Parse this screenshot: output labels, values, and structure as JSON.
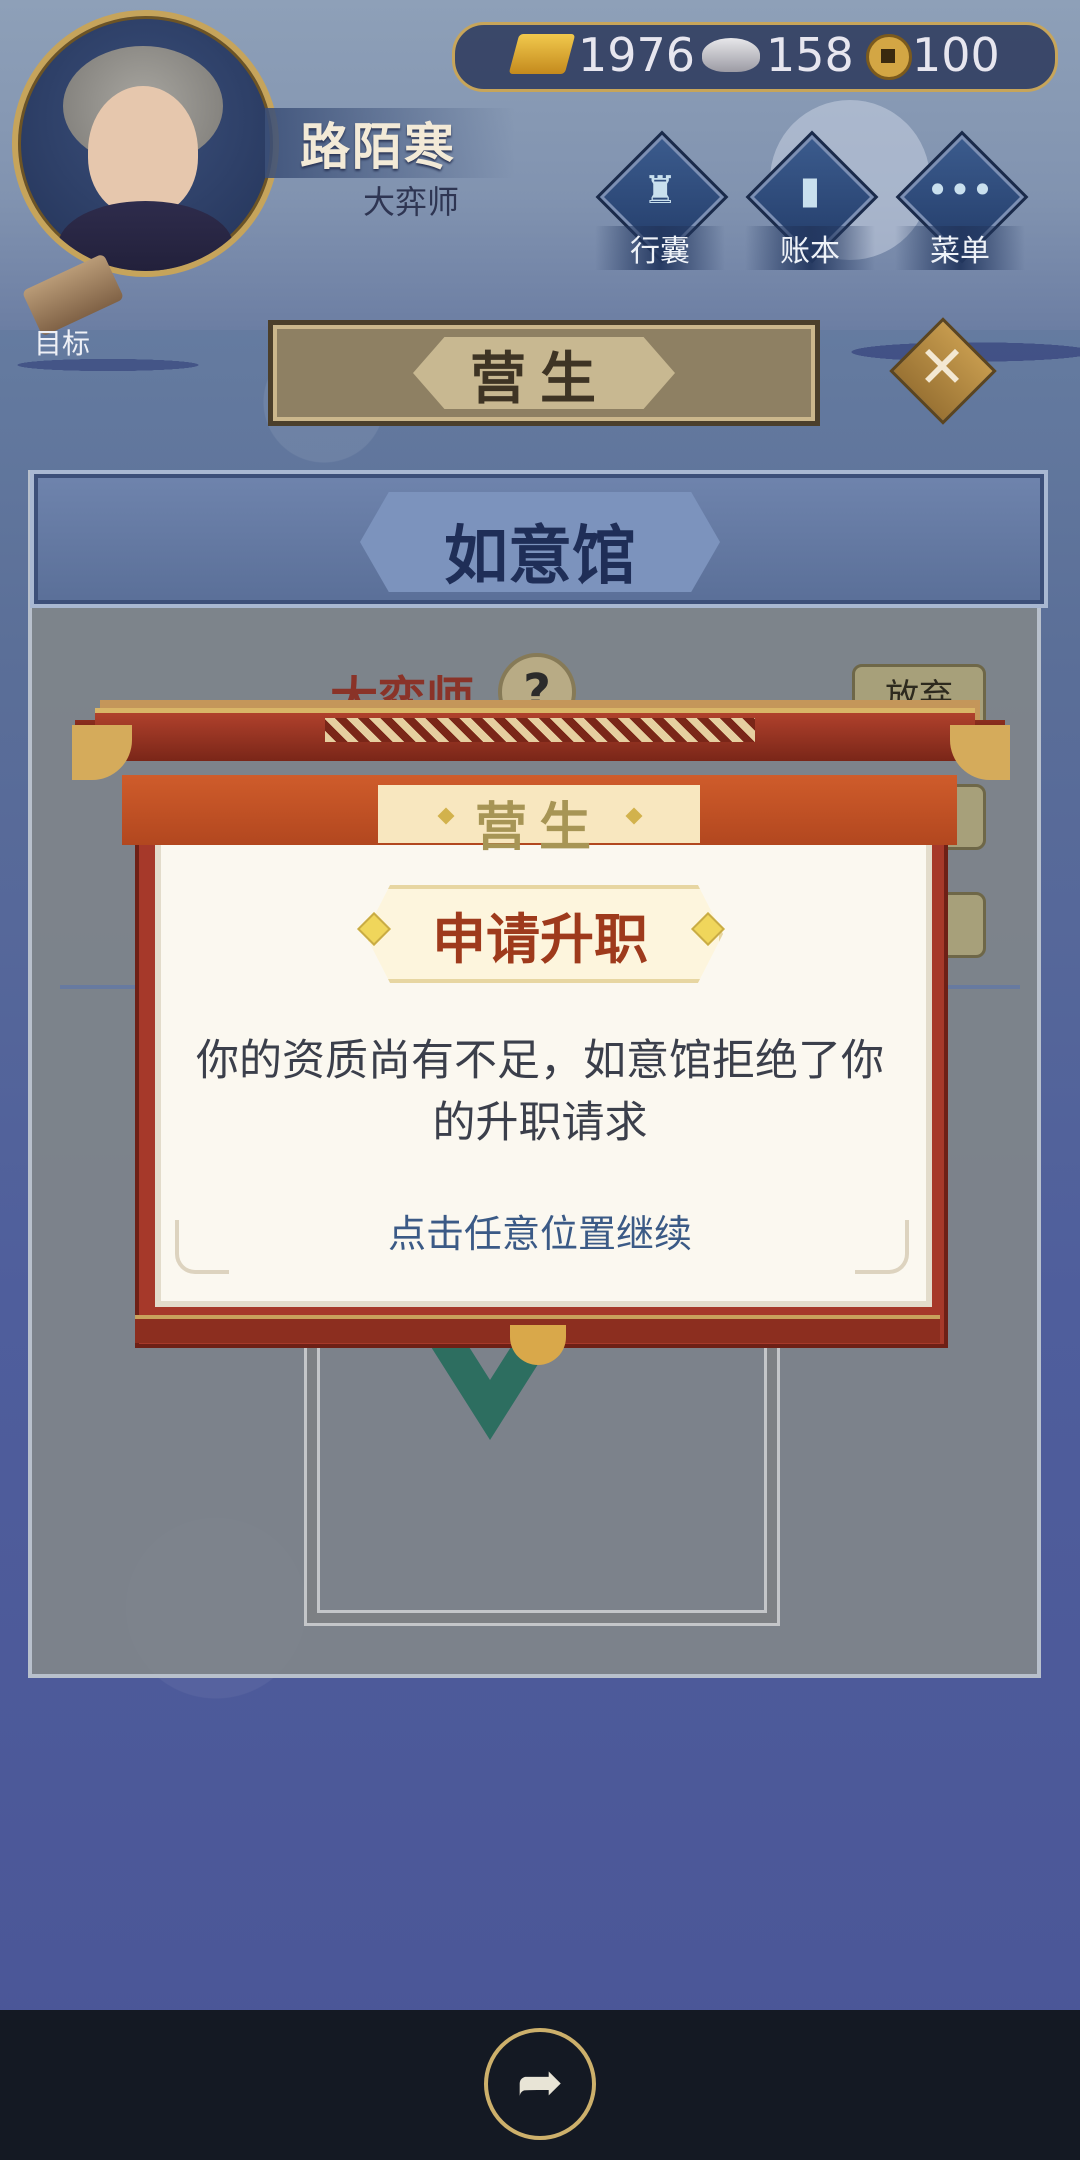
{
  "player": {
    "name": "路陌寒",
    "title": "大弈师"
  },
  "currency": {
    "gold": "1976",
    "silver": "158",
    "coin": "100"
  },
  "menu": [
    {
      "label": "行囊",
      "icon": "bag-icon"
    },
    {
      "label": "账本",
      "icon": "ledger-icon"
    },
    {
      "label": "菜单",
      "icon": "more-icon"
    }
  ],
  "target_label": "目标",
  "header": {
    "title": "营生"
  },
  "panel": {
    "banner": "如意馆",
    "role_title": "大弈师",
    "help": "?",
    "give_up": "放弃"
  },
  "dialog": {
    "tag": "营生",
    "title": "申请升职",
    "body": "你的资质尚有不足，如意馆拒绝了你的升职请求",
    "hint": "点击任意位置继续"
  },
  "colors": {
    "accent_gold": "#c7a55a",
    "dialog_red": "#a6392a",
    "title_red": "#9e3a1c"
  }
}
